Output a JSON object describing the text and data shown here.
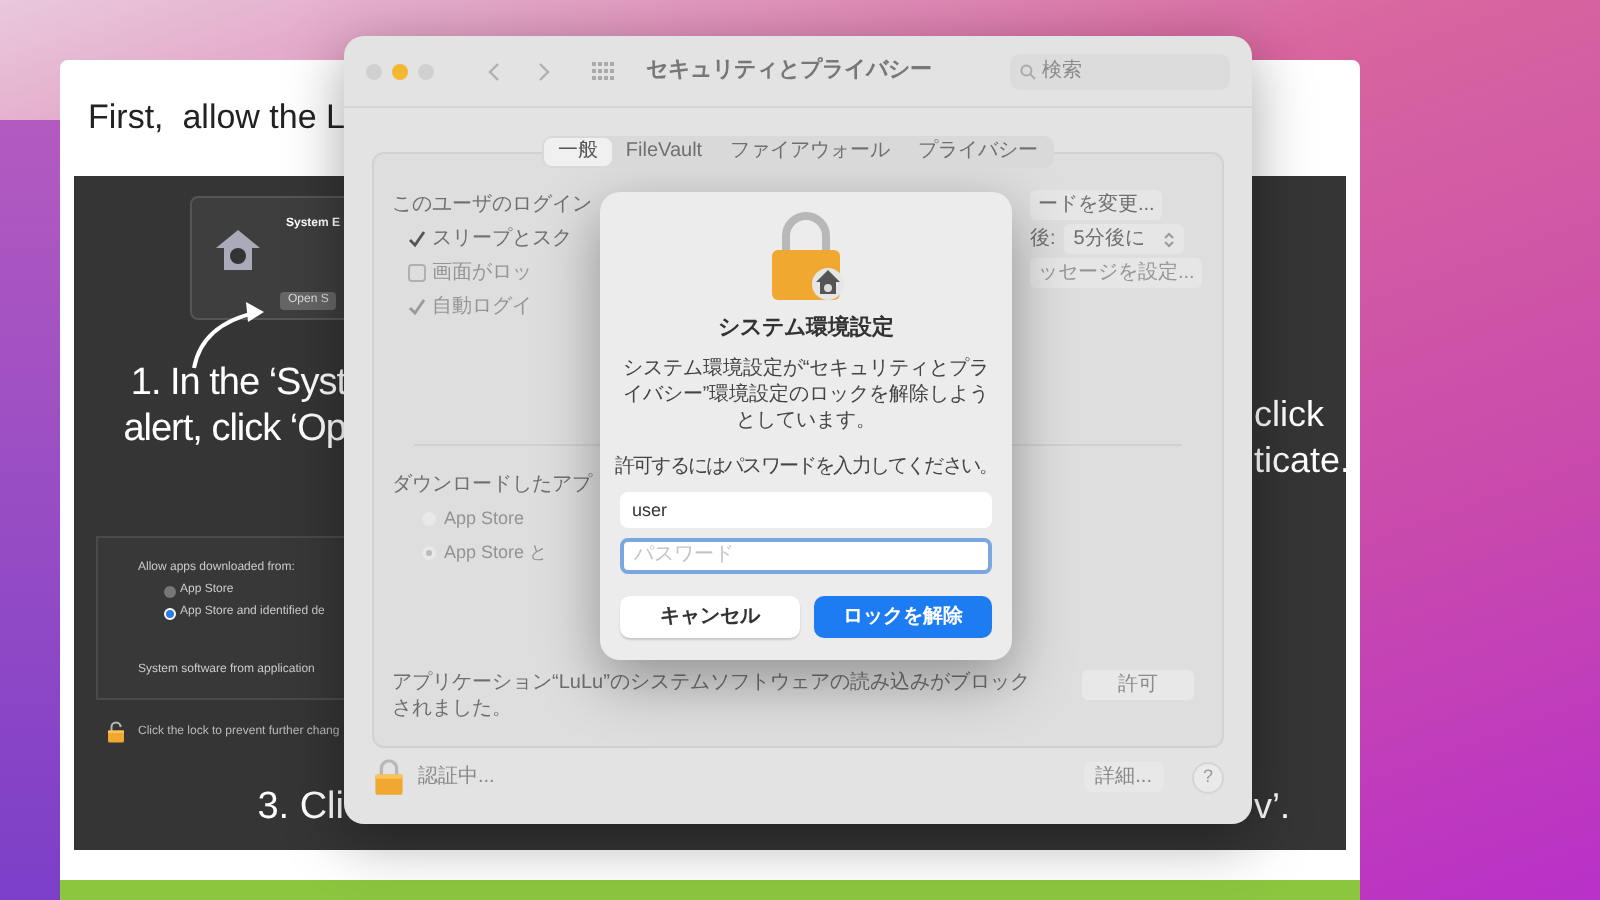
{
  "tutorial": {
    "heading": "First,  allow the L",
    "alert": {
      "title": "System E",
      "button": "Open S"
    },
    "step1": [
      "1. In the ‘Syst",
      "alert, click ‘Op"
    ],
    "step2": [
      "click",
      "ticate."
    ],
    "settings": {
      "label": "Allow apps downloaded from:",
      "options": [
        {
          "label": "App Store",
          "selected": false
        },
        {
          "label": "App Store and identified de",
          "selected": true
        }
      ],
      "note": "System software from application",
      "lock_text": "Click the lock to prevent further chang"
    },
    "step3": [
      "3. Cli",
      "v’."
    ]
  },
  "window": {
    "title": "セキュリティとプライバシー",
    "search": {
      "placeholder": "検索"
    },
    "tabs": [
      {
        "label": "一般",
        "selected": true
      },
      {
        "label": "FileVault",
        "selected": false
      },
      {
        "label": "ファイアウォール",
        "selected": false
      },
      {
        "label": "プライバシー",
        "selected": false
      }
    ],
    "login": {
      "text": "このユーザのログイン",
      "button": "ードを変更..."
    },
    "options": [
      {
        "kind": "checkbox",
        "label": "スリープとスク",
        "checked": true,
        "disabled": false,
        "suffix": "後:",
        "popup": "5分後に"
      },
      {
        "kind": "checkbox",
        "label": "画面がロッ",
        "checked": false,
        "disabled": true,
        "button": "ッセージを設定..."
      },
      {
        "kind": "checkbox",
        "label": "自動ログイ",
        "checked": true,
        "disabled": true
      }
    ],
    "downloads": {
      "label": "ダウンロードしたアプ",
      "options": [
        {
          "label": "App Store",
          "selected": false
        },
        {
          "label": "App Store と",
          "selected": true
        }
      ]
    },
    "blocked": {
      "text": "アプリケーション“LuLu”のシステムソフトウェアの読み込みがブロックされました。",
      "button": "許可"
    },
    "footer": {
      "status": "認証中...",
      "details": "詳細...",
      "help": "?"
    }
  },
  "dialog": {
    "title": "システム環境設定",
    "message": "システム環境設定が“セキュリティとプライバシー”環境設定のロックを解除しようとしています。",
    "prompt": "許可するにはパスワードを入力してください。",
    "username": "user",
    "password": {
      "placeholder": "パスワード"
    },
    "buttons": [
      {
        "label": "キャンセル",
        "kind": "secondary"
      },
      {
        "label": "ロックを解除",
        "kind": "primary"
      }
    ]
  }
}
